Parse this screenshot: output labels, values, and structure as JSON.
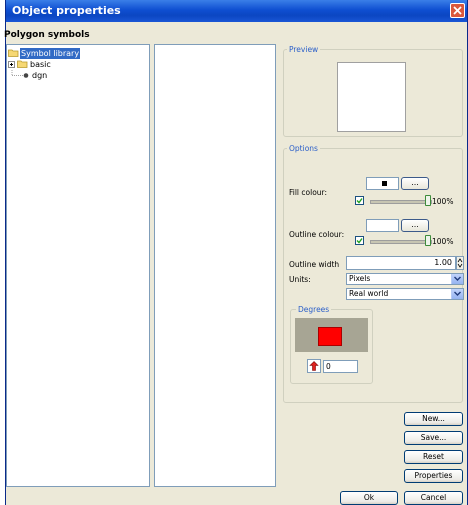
{
  "window": {
    "title": "Object properties"
  },
  "section": {
    "title": "Polygon symbols"
  },
  "tree": {
    "root": "Symbol library",
    "children": [
      {
        "label": "basic",
        "expand": "+"
      },
      {
        "label": "dgn"
      }
    ]
  },
  "preview": {
    "label": "Preview"
  },
  "options": {
    "label": "Options",
    "fill_colour_label": "Fill colour:",
    "fill_colour_value": "#000000",
    "fill_browse_label": "...",
    "fill_opacity": "100%",
    "fill_opacity_value": 100,
    "outline_colour_label": "Outline colour:",
    "outline_browse_label": "...",
    "outline_opacity": "100%",
    "outline_opacity_value": 100,
    "outline_width_label": "Outline width",
    "outline_width_value": "1.00",
    "units_label": "Units:",
    "units_value": "Pixels",
    "scale_value": "Real world"
  },
  "degrees": {
    "label": "Degrees",
    "swatch_color": "#ff0000",
    "angle_value": "0"
  },
  "buttons": {
    "new": "New...",
    "save": "Save...",
    "reset": "Reset",
    "properties": "Properties",
    "ok": "Ok",
    "cancel": "Cancel"
  }
}
